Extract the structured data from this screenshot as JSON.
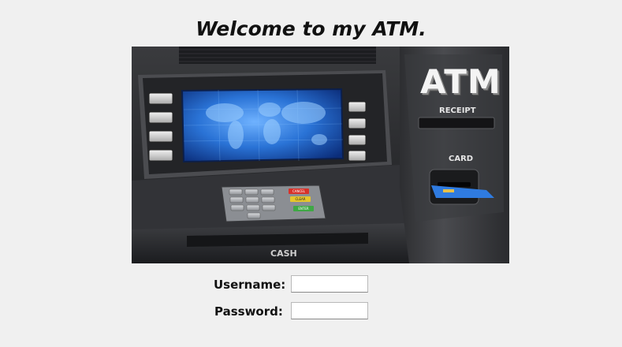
{
  "header": {
    "title": "Welcome to my ATM."
  },
  "atm_image": {
    "brand_text": "ATM",
    "receipt_label": "RECEIPT",
    "card_label": "CARD",
    "cash_label": "CASH",
    "keypad_keys": [
      "CANCEL",
      "CLEAR",
      "ENTER"
    ]
  },
  "login": {
    "username_label": "Username:",
    "username_value": "",
    "password_label": "Password:",
    "password_value": ""
  }
}
